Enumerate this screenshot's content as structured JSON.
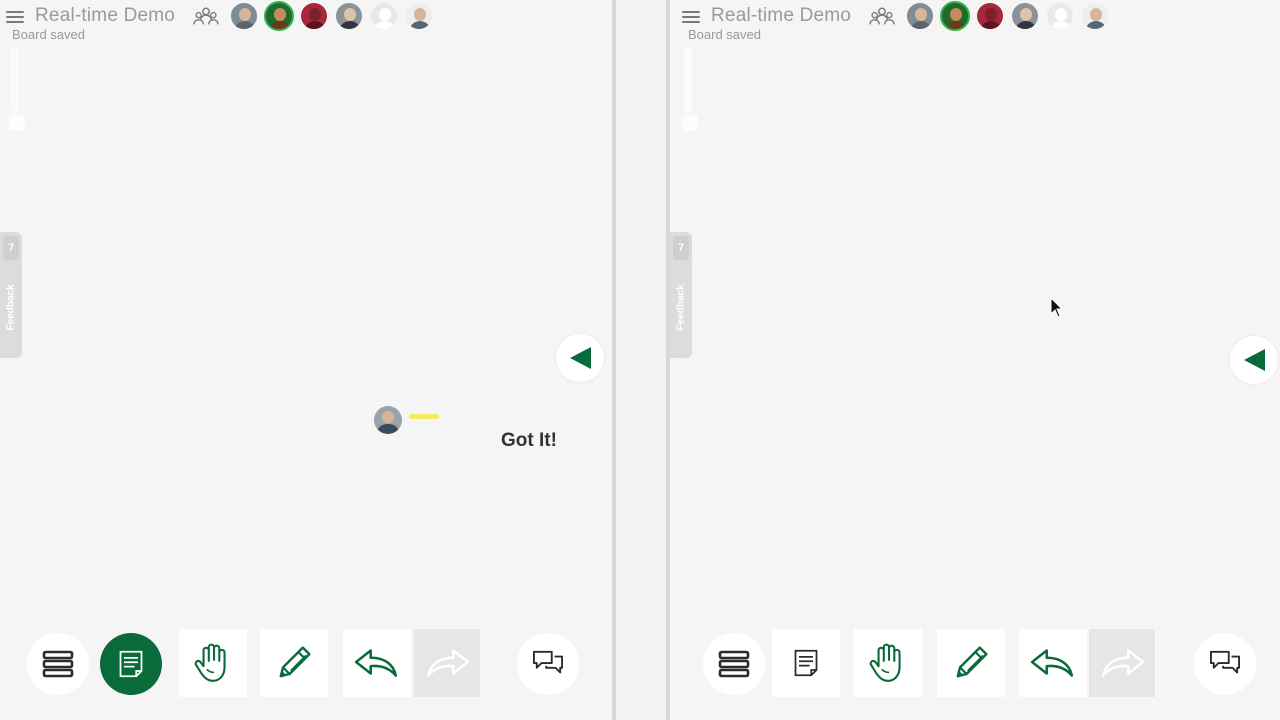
{
  "colors": {
    "accent": "#0a6b3a",
    "icon_stroke": "#2b2b2b",
    "muted_text": "#9a9a9a",
    "yellow_pen": "#f2ea46"
  },
  "left_pane": {
    "header": {
      "menu_icon": "hamburger-icon",
      "title": "Real-time Demo",
      "status": "Board saved",
      "collaborators_icon": "users-icon",
      "avatars": [
        "avatar-user-1",
        "avatar-user-2",
        "avatar-user-3",
        "avatar-user-4",
        "avatar-user-5",
        "avatar-user-6"
      ]
    },
    "feedback": {
      "count": "7",
      "label": "Feedback"
    },
    "canvas": {
      "got_it": "Got It!"
    },
    "toolbar": [
      "layers-icon",
      "notes-icon",
      "hand-icon",
      "pencil-icon",
      "undo-icon",
      "redo-icon",
      "chat-icon"
    ]
  },
  "right_pane": {
    "header": {
      "menu_icon": "hamburger-icon",
      "title": "Real-time Demo",
      "status": "Board saved",
      "collaborators_icon": "users-icon",
      "avatars": [
        "avatar-user-1",
        "avatar-user-2",
        "avatar-user-3",
        "avatar-user-4",
        "avatar-user-5",
        "avatar-user-6"
      ]
    },
    "feedback": {
      "count": "7",
      "label": "Feedback"
    },
    "toolbar": [
      "layers-icon",
      "notes-icon",
      "hand-icon",
      "pencil-icon",
      "undo-icon",
      "redo-icon",
      "chat-icon"
    ]
  }
}
